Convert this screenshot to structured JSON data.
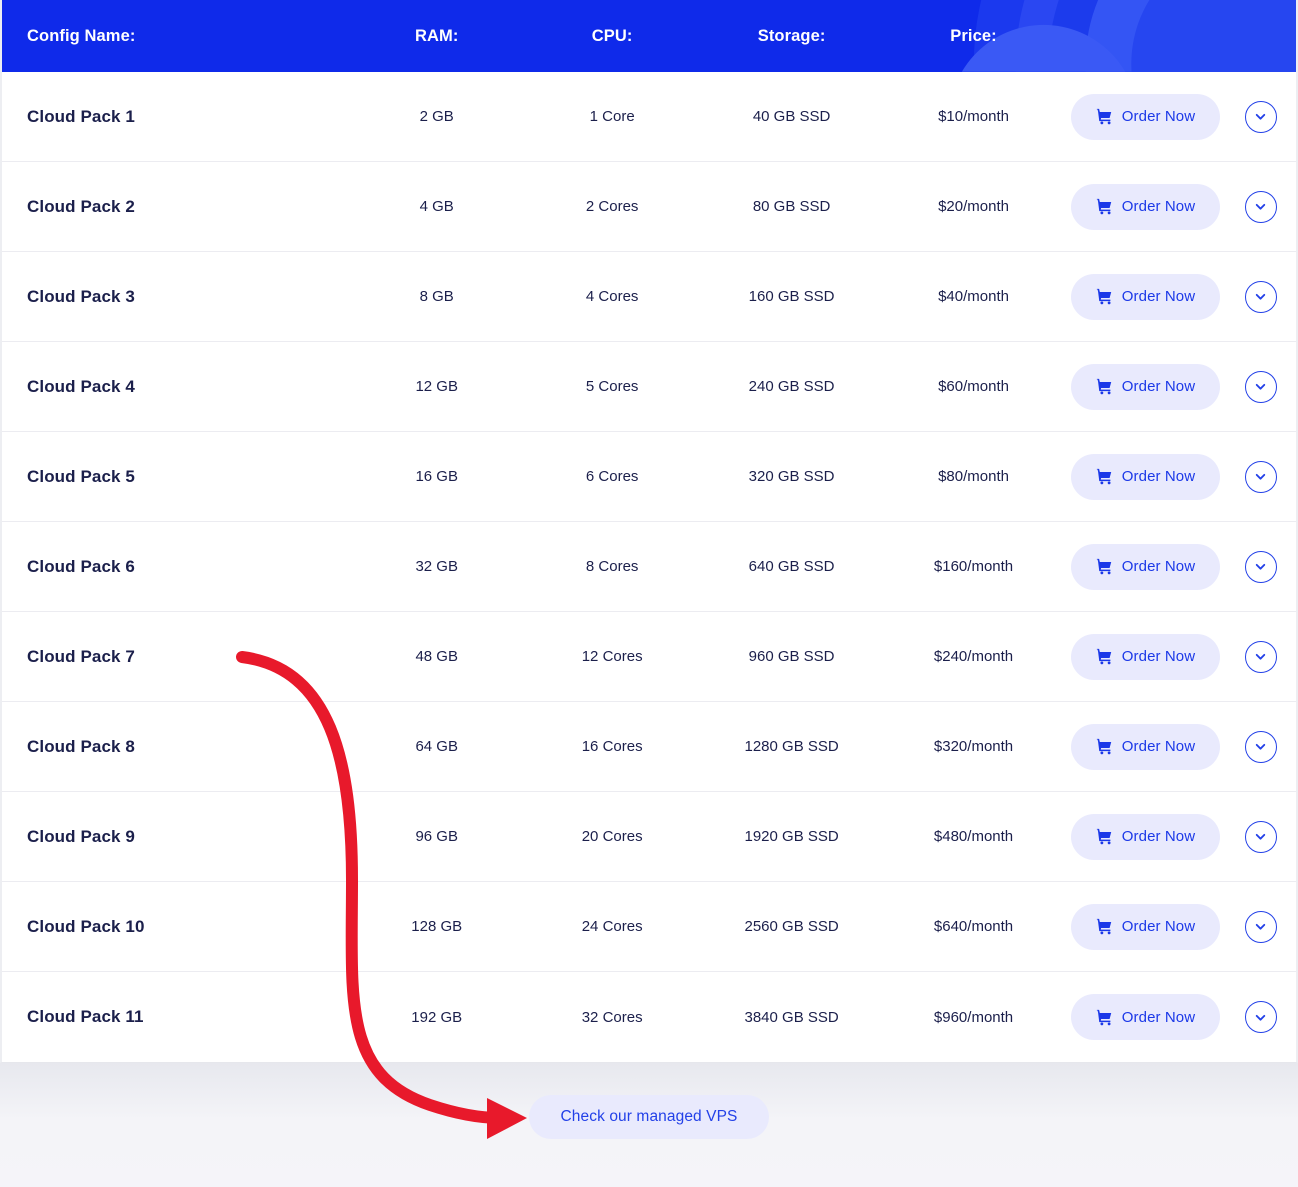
{
  "table": {
    "columns": [
      {
        "key": "name",
        "label": "Config Name:"
      },
      {
        "key": "ram",
        "label": "RAM:"
      },
      {
        "key": "cpu",
        "label": "CPU:"
      },
      {
        "key": "storage",
        "label": "Storage:"
      },
      {
        "key": "price",
        "label": "Price:"
      }
    ],
    "rows": [
      {
        "name": "Cloud Pack 1",
        "ram": "2 GB",
        "cpu": "1 Core",
        "storage": "40 GB SSD",
        "price": "$10/month"
      },
      {
        "name": "Cloud Pack 2",
        "ram": "4 GB",
        "cpu": "2 Cores",
        "storage": "80 GB SSD",
        "price": "$20/month"
      },
      {
        "name": "Cloud Pack 3",
        "ram": "8 GB",
        "cpu": "4 Cores",
        "storage": "160 GB SSD",
        "price": "$40/month"
      },
      {
        "name": "Cloud Pack 4",
        "ram": "12 GB",
        "cpu": "5 Cores",
        "storage": "240 GB SSD",
        "price": "$60/month"
      },
      {
        "name": "Cloud Pack 5",
        "ram": "16 GB",
        "cpu": "6 Cores",
        "storage": "320 GB SSD",
        "price": "$80/month"
      },
      {
        "name": "Cloud Pack 6",
        "ram": "32 GB",
        "cpu": "8 Cores",
        "storage": "640 GB SSD",
        "price": "$160/month"
      },
      {
        "name": "Cloud Pack 7",
        "ram": "48 GB",
        "cpu": "12 Cores",
        "storage": "960 GB SSD",
        "price": "$240/month"
      },
      {
        "name": "Cloud Pack 8",
        "ram": "64 GB",
        "cpu": "16 Cores",
        "storage": "1280 GB SSD",
        "price": "$320/month"
      },
      {
        "name": "Cloud Pack 9",
        "ram": "96 GB",
        "cpu": "20 Cores",
        "storage": "1920 GB SSD",
        "price": "$480/month"
      },
      {
        "name": "Cloud Pack 10",
        "ram": "128 GB",
        "cpu": "24 Cores",
        "storage": "2560 GB SSD",
        "price": "$640/month"
      },
      {
        "name": "Cloud Pack 11",
        "ram": "192 GB",
        "cpu": "32 Cores",
        "storage": "3840 GB SSD",
        "price": "$960/month"
      }
    ],
    "order_button_label": "Order Now",
    "order_button_icon": "shopping-cart-icon",
    "expand_button_icon": "chevron-down-icon"
  },
  "footer": {
    "cta_label": "Check our managed VPS"
  },
  "annotation": {
    "type": "curved-arrow",
    "color": "#e8192b",
    "points_from": "Cloud Pack 7 row",
    "points_to": "Check our managed VPS button"
  },
  "colors": {
    "header_blue": "#0f2aea",
    "accent_blue": "#2341e8",
    "button_bg": "#e9eafd",
    "text_navy": "#1b1f4b",
    "row_divider": "#ececf1",
    "footer_bg": "#f4f4f8",
    "annotation_red": "#e8192b"
  }
}
